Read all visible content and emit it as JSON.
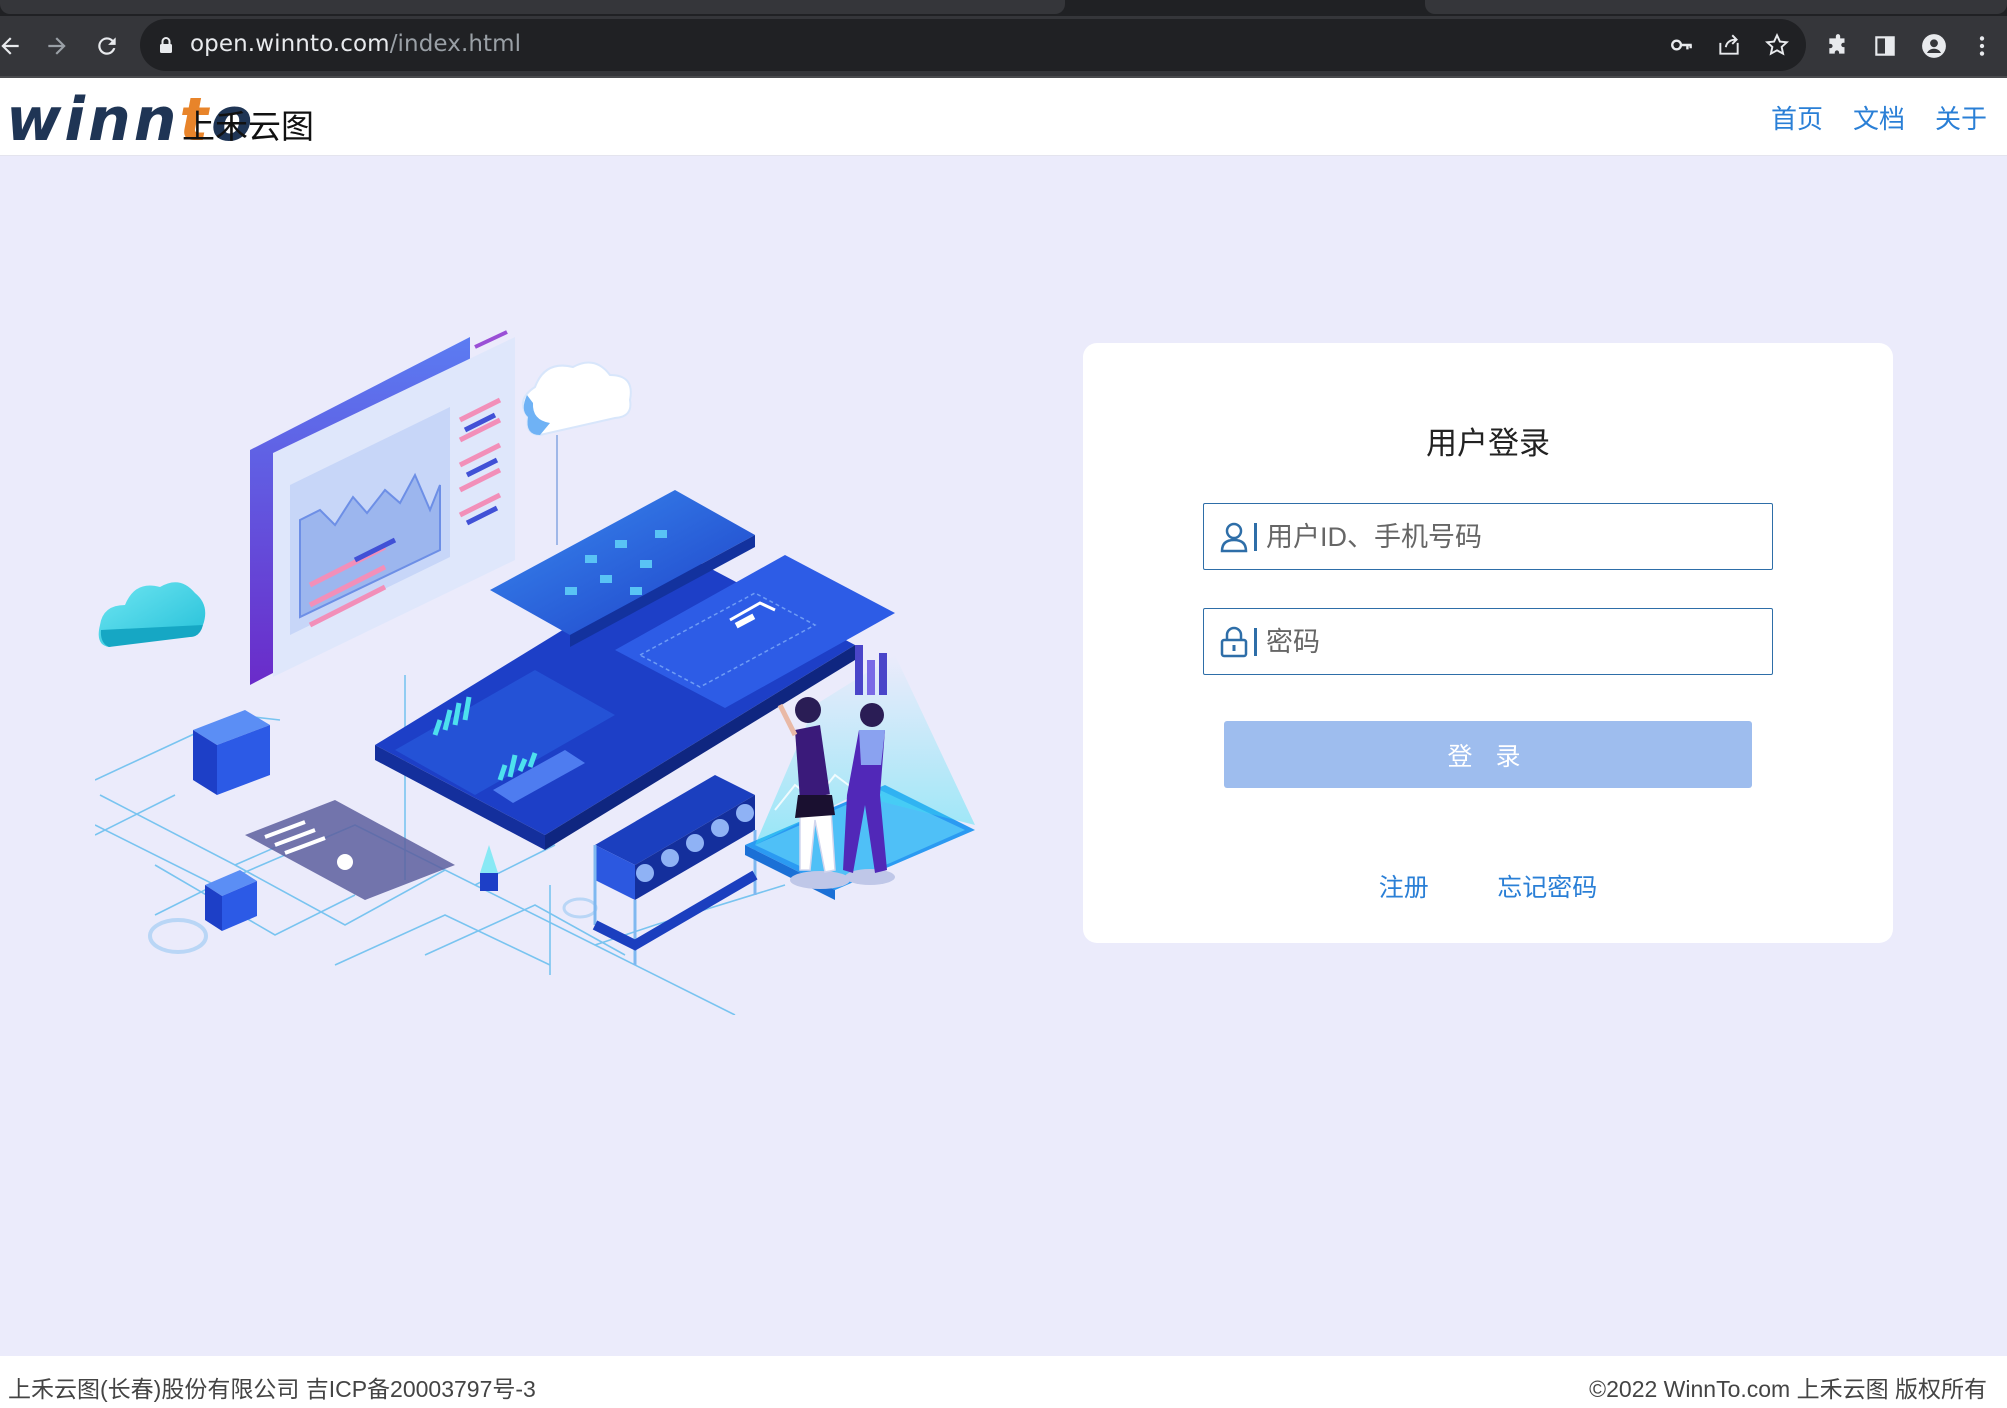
{
  "browser": {
    "url_host": "open.winnto.com",
    "url_path": "/index.html"
  },
  "header": {
    "logo_prefix": "winn",
    "logo_accent": "t",
    "logo_suffix": "o",
    "brand_name": "上禾云图",
    "nav": [
      "首页",
      "文档",
      "关于"
    ]
  },
  "login": {
    "title": "用户登录",
    "username_placeholder": "用户ID、手机号码",
    "password_placeholder": "密码",
    "submit_label": "登 录",
    "register_label": "注册",
    "forgot_label": "忘记密码"
  },
  "footer": {
    "company": "上禾云图(长春)股份有限公司 吉ICP备20003797号-3",
    "copyright": "©2022 WinnTo.com 上禾云图 版权所有"
  },
  "colors": {
    "page_bg": "#ebebfb",
    "link": "#2a7fd6",
    "login_button": "#9ebdee",
    "input_border": "#2e6ea8",
    "logo_dark": "#1f3555",
    "logo_accent": "#e8842a"
  }
}
